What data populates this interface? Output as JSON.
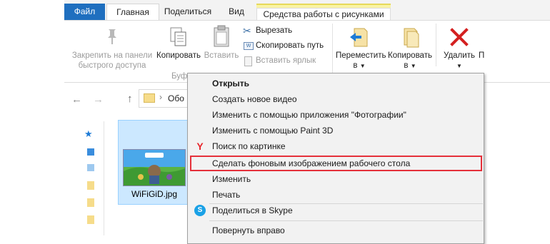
{
  "ribbon": {
    "tabs": {
      "file": "Файл",
      "home": "Главная",
      "share": "Поделиться",
      "view": "Вид",
      "picture_tools": "Средства работы с рисунками"
    },
    "clipboard": {
      "pin_line1": "Закрепить на панели",
      "pin_line2": "быстрого доступа",
      "copy": "Копировать",
      "paste": "Вставить",
      "cut": "Вырезать",
      "copy_path": "Скопировать путь",
      "paste_shortcut": "Вставить ярлык",
      "group_label": "Буфе"
    },
    "organize": {
      "move_line1": "Переместить",
      "move_line2": "в",
      "copy_to_line1": "Копировать",
      "copy_to_line2": "в",
      "delete": "Удалить",
      "rename_partial": "П"
    }
  },
  "navigation": {
    "breadcrumb_partial": "Обо"
  },
  "file": {
    "name": "WiFiGiD.jpg"
  },
  "context_menu": {
    "items": [
      {
        "label": "Открыть",
        "bold": true
      },
      {
        "label": "Создать новое видео"
      },
      {
        "label": "Изменить с помощью приложения \"Фотографии\""
      },
      {
        "label": "Изменить с помощью Paint 3D"
      },
      {
        "label": "Поиск по картинке",
        "icon": "yandex-icon"
      },
      {
        "label": "Сделать фоновым изображением рабочего стола",
        "highlighted": true
      },
      {
        "label": "Изменить"
      },
      {
        "label": "Печать"
      },
      {
        "label": "Поделиться в Skype",
        "icon": "skype-icon"
      },
      {
        "label": "Повернуть вправо"
      }
    ]
  },
  "colors": {
    "file_tab": "#1f6fbf",
    "picture_tools_tab": "#f9f3a5",
    "selection": "#cce8ff",
    "highlight_border": "#e5303a",
    "delete_red": "#d42020"
  }
}
